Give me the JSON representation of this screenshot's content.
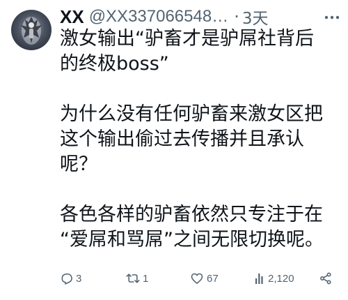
{
  "tweet": {
    "author": {
      "display_name": "XX",
      "handle": "@XX337066548…",
      "avatar_icon": "avatar-image"
    },
    "separator": "·",
    "time": "3天",
    "paragraphs": [
      [
        "激女输出“驴畜才是驴屌社背后",
        "的终极boss”"
      ],
      [
        "为什么没有任何驴畜来激女区把",
        "这个输出偷过去传播并且承认",
        "呢？"
      ],
      [
        "各色各样的驴畜依然只专注于在",
        "“爱屌和骂屌”之间无限切换呢。"
      ]
    ],
    "actions": {
      "reply": {
        "icon": "reply-icon",
        "count": "3"
      },
      "retweet": {
        "icon": "retweet-icon",
        "count": "1"
      },
      "like": {
        "icon": "heart-icon",
        "count": "67"
      },
      "views": {
        "icon": "views-icon",
        "count": "2,120"
      },
      "share": {
        "icon": "share-icon",
        "count": ""
      }
    }
  },
  "colors": {
    "text": "#0f1419",
    "secondary": "#536471"
  }
}
